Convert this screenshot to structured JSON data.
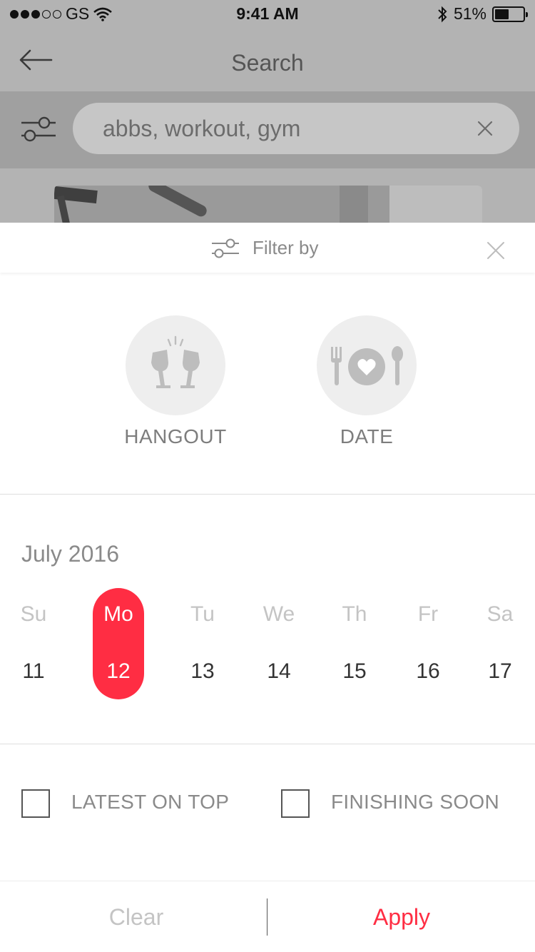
{
  "status_bar": {
    "carrier": "GS",
    "time": "9:41 AM",
    "battery_percent": "51%",
    "battery_level": 0.51,
    "signal_dots_filled": 3,
    "signal_dots_total": 5,
    "icons": [
      "wifi-icon",
      "bluetooth-icon",
      "battery-icon"
    ]
  },
  "nav": {
    "title": "Search",
    "back_icon": "arrow-left-icon"
  },
  "search": {
    "query": "abbs, workout, gym",
    "filter_icon": "sliders-icon",
    "clear_icon": "close-icon"
  },
  "filter_sheet": {
    "title": "Filter by",
    "header_icon": "sliders-icon",
    "close_icon": "close-icon",
    "categories": [
      {
        "label": "HANGOUT",
        "icon": "toast-glasses-icon"
      },
      {
        "label": "DATE",
        "icon": "dinner-plate-heart-icon"
      }
    ],
    "calendar": {
      "month": "July 2016",
      "days": [
        {
          "name": "Su",
          "num": "11",
          "selected": false
        },
        {
          "name": "Mo",
          "num": "12",
          "selected": true
        },
        {
          "name": "Tu",
          "num": "13",
          "selected": false
        },
        {
          "name": "We",
          "num": "14",
          "selected": false
        },
        {
          "name": "Th",
          "num": "15",
          "selected": false
        },
        {
          "name": "Fr",
          "num": "16",
          "selected": false
        },
        {
          "name": "Sa",
          "num": "17",
          "selected": false
        }
      ]
    },
    "options": [
      {
        "label": "LATEST ON TOP",
        "checked": false
      },
      {
        "label": "FINISHING SOON",
        "checked": false
      }
    ],
    "footer": {
      "clear_label": "Clear",
      "apply_label": "Apply"
    }
  },
  "colors": {
    "accent": "#ff2d43",
    "muted_text": "#8a8a8a",
    "day_name": "#c4c4c4",
    "overlay_bg": "#b3b3b3"
  }
}
